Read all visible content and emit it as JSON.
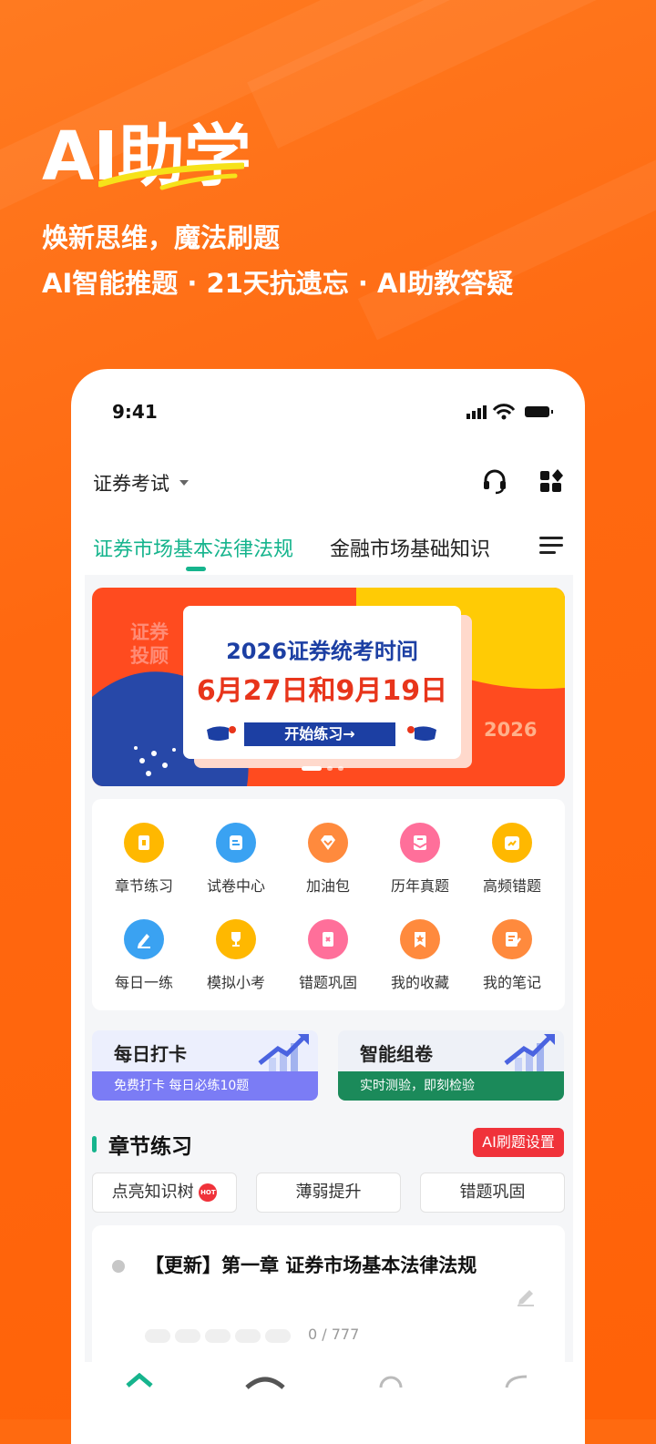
{
  "hero": {
    "title": "AI助学",
    "subtitle1": "焕新思维，魔法刷题",
    "subtitle2": "AI智能推题 · 21天抗遗忘 · AI助教答疑"
  },
  "status": {
    "time": "9:41"
  },
  "header": {
    "exam_selector": "证券考试",
    "icons": [
      "headset-icon",
      "apps-icon"
    ]
  },
  "tabs": [
    {
      "label": "证券市场基本法律法规",
      "active": true
    },
    {
      "label": "金融市场基础知识",
      "active": false
    }
  ],
  "banner": {
    "side_text": "证券投顾",
    "line1": "2026证券统考时间",
    "line2": "6月27日和9月19日",
    "button": "开始练习→",
    "year": "2026"
  },
  "grid": [
    {
      "label": "章节练习",
      "icon": "chapter-icon",
      "color": "#ffb800"
    },
    {
      "label": "试卷中心",
      "icon": "paper-icon",
      "color": "#3aa2f2"
    },
    {
      "label": "加油包",
      "icon": "diamond-icon",
      "color": "#ff8a3d"
    },
    {
      "label": "历年真题",
      "icon": "past-exam-icon",
      "color": "#ff6f9a"
    },
    {
      "label": "高频错题",
      "icon": "calendar-chart-icon",
      "color": "#ffb800"
    },
    {
      "label": "每日一练",
      "icon": "pencil-icon",
      "color": "#3aa2f2"
    },
    {
      "label": "模拟小考",
      "icon": "trophy-icon",
      "color": "#ffb800"
    },
    {
      "label": "错题巩固",
      "icon": "wrong-book-icon",
      "color": "#ff6f9a"
    },
    {
      "label": "我的收藏",
      "icon": "star-bookmark-icon",
      "color": "#ff8a3d"
    },
    {
      "label": "我的笔记",
      "icon": "note-icon",
      "color": "#ff8a3d"
    }
  ],
  "promos": [
    {
      "title": "每日打卡",
      "sub": "免费打卡 每日必练10题",
      "color": "#7b7cf5",
      "bg": "#eceffd"
    },
    {
      "title": "智能组卷",
      "sub": "实时测验，即刻检验",
      "color": "#1b8a5a",
      "bg": "#eef1f7"
    }
  ],
  "section": {
    "title": "章节练习",
    "ai_button": "AI刷题设置",
    "pills": [
      "点亮知识树",
      "薄弱提升",
      "错题巩固"
    ],
    "hot_badge": "HOT"
  },
  "chapter": {
    "title": "【更新】第一章 证券市场基本法律法规",
    "progress": "0 / 777",
    "done": 0,
    "total": 777
  },
  "colors": {
    "brand_orange": "#ff6a10",
    "accent_green": "#16b48d"
  }
}
